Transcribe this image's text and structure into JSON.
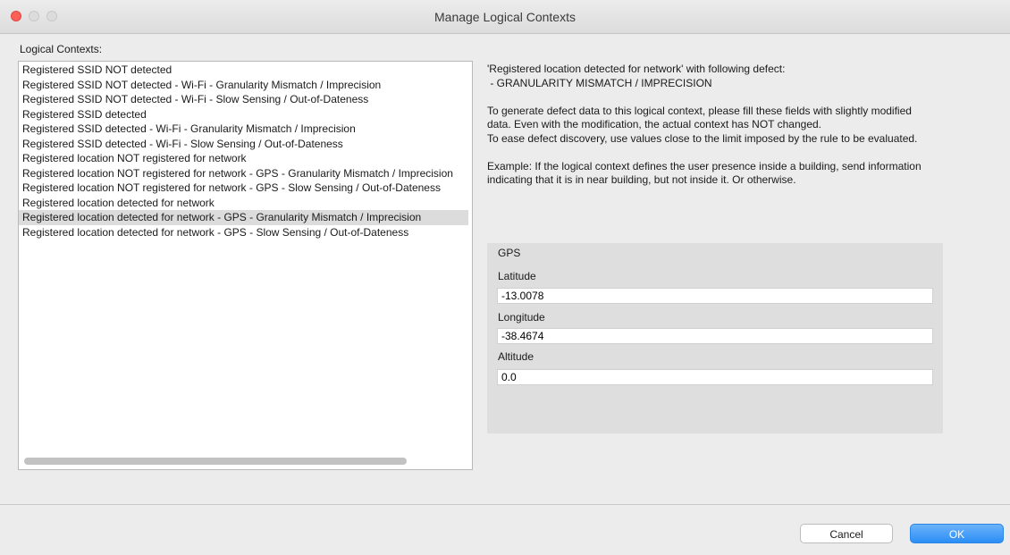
{
  "window": {
    "title": "Manage Logical Contexts"
  },
  "list": {
    "label": "Logical Contexts:",
    "items": [
      "Registered SSID NOT detected",
      "Registered SSID NOT detected - Wi-Fi - Granularity Mismatch / Imprecision",
      "Registered SSID NOT detected - Wi-Fi - Slow Sensing / Out-of-Dateness",
      "Registered SSID detected",
      "Registered SSID detected - Wi-Fi - Granularity Mismatch / Imprecision",
      "Registered SSID detected - Wi-Fi - Slow Sensing / Out-of-Dateness",
      "Registered location NOT registered for network",
      "Registered location NOT registered for network - GPS - Granularity Mismatch / Imprecision",
      "Registered location NOT registered for network - GPS - Slow Sensing / Out-of-Dateness",
      "Registered location detected for network",
      "Registered location detected for network - GPS - Granularity Mismatch / Imprecision",
      "Registered location detected for network - GPS - Slow Sensing / Out-of-Dateness"
    ],
    "selected_index": 10
  },
  "description": {
    "line1": "'Registered location detected for network' with following defect:",
    "line2": " - GRANULARITY MISMATCH / IMPRECISION",
    "para1": "To generate defect data to this logical context, please fill these fields with slightly modified data. Even with the modification, the actual context has NOT changed.",
    "para2": "To ease defect discovery, use values close to the limit imposed by the rule to be evaluated.",
    "para3": "Example: If the logical context defines the user presence inside a building, send information indicating that it is in near building, but not inside it. Or otherwise."
  },
  "gps": {
    "title": "GPS",
    "latitude_label": "Latitude",
    "latitude_value": "-13.0078",
    "longitude_label": "Longitude",
    "longitude_value": "-38.4674",
    "altitude_label": "Altitude",
    "altitude_value": "0.0"
  },
  "buttons": {
    "cancel": "Cancel",
    "ok": "OK"
  },
  "colors": {
    "accent": "#2b8ef5",
    "selection": "#dcdcdc",
    "close": "#fc5f57"
  }
}
